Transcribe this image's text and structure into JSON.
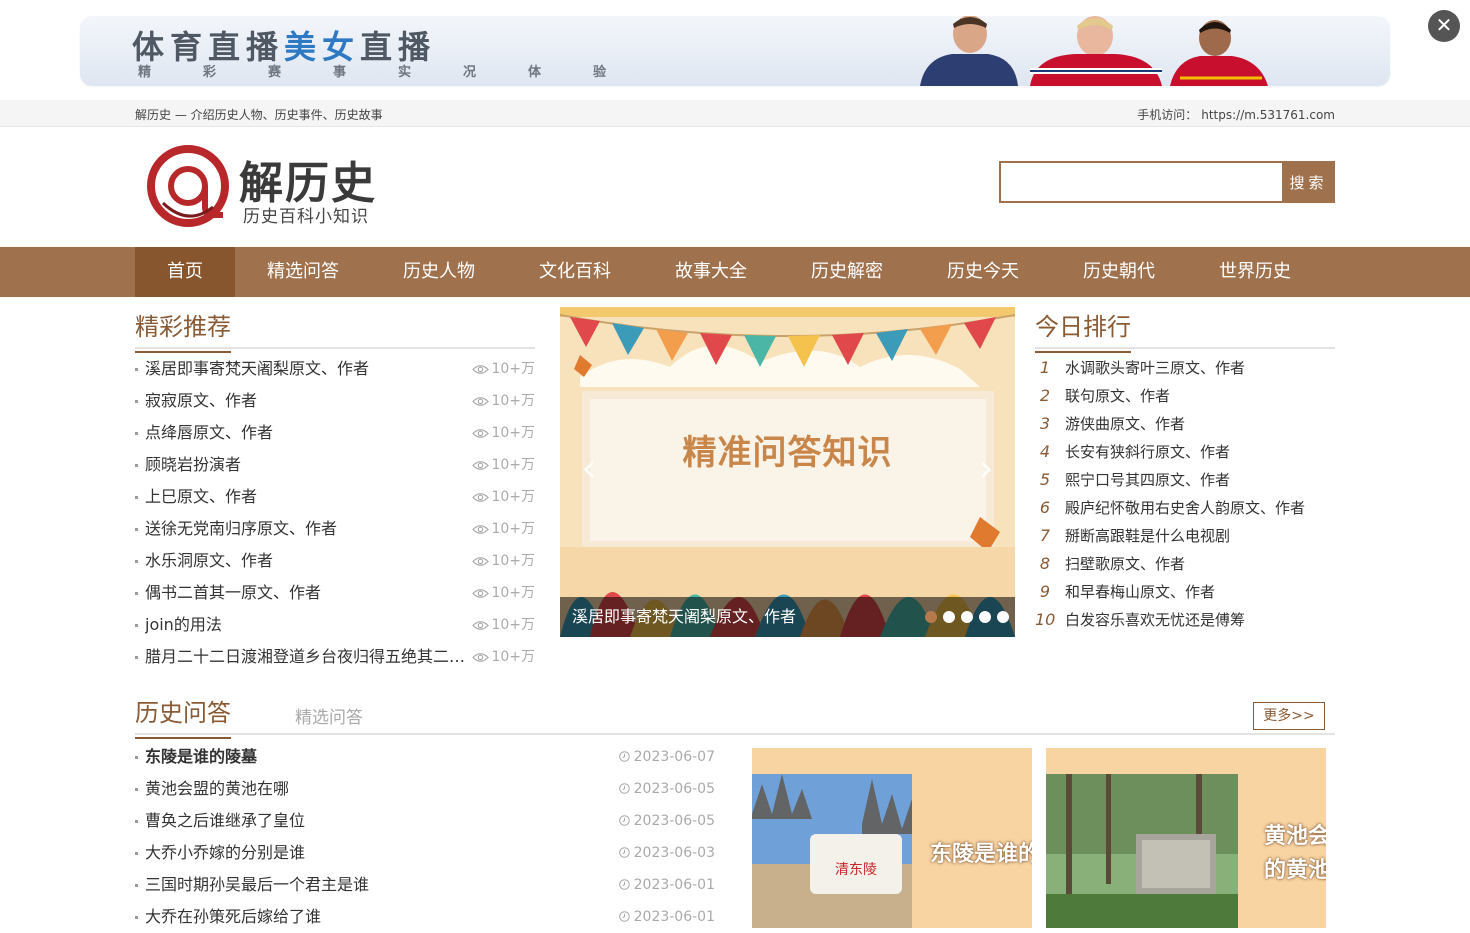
{
  "ad": {
    "title_part1": "体育直播",
    "title_part2": "美女",
    "title_part3": "直播",
    "subtitle": "精彩赛事实况体验"
  },
  "topbar": {
    "tagline": "解历史 — 介绍历史人物、历史事件、历史故事",
    "mobile_label": "手机访问：",
    "mobile_url": "https://m.531761.com"
  },
  "logo": {
    "name": "解历史",
    "tagline": "历史百科小知识"
  },
  "search": {
    "placeholder": "",
    "button": "搜索"
  },
  "nav": [
    "首页",
    "精选问答",
    "历史人物",
    "文化百科",
    "故事大全",
    "历史解密",
    "历史今天",
    "历史朝代",
    "世界历史"
  ],
  "recommend": {
    "title": "精彩推荐",
    "items": [
      {
        "title": "溪居即事寄梵天阇梨原文、作者",
        "views": "10+万"
      },
      {
        "title": "寂寂原文、作者",
        "views": "10+万"
      },
      {
        "title": "点绛唇原文、作者",
        "views": "10+万"
      },
      {
        "title": "顾晓岩扮演者",
        "views": "10+万"
      },
      {
        "title": "上巳原文、作者",
        "views": "10+万"
      },
      {
        "title": "送徐无党南归序原文、作者",
        "views": "10+万"
      },
      {
        "title": "水乐洞原文、作者",
        "views": "10+万"
      },
      {
        "title": "偶书二首其一原文、作者",
        "views": "10+万"
      },
      {
        "title": "join的用法",
        "views": "10+万"
      },
      {
        "title": "腊月二十二日渡湘登道乡台夜归得五绝其二原文、作者",
        "views": "10+万"
      }
    ]
  },
  "slider": {
    "headline": "精准问答知识",
    "caption": "溪居即事寄梵天阇梨原文、作者",
    "prev": "‹",
    "next": "›",
    "active_dot": 0,
    "dot_count": 5
  },
  "ranking": {
    "title": "今日排行",
    "items": [
      {
        "n": "1",
        "title": "水调歌头寄叶三原文、作者"
      },
      {
        "n": "2",
        "title": "联句原文、作者"
      },
      {
        "n": "3",
        "title": "游侠曲原文、作者"
      },
      {
        "n": "4",
        "title": "长安有狭斜行原文、作者"
      },
      {
        "n": "5",
        "title": "熙宁口号其四原文、作者"
      },
      {
        "n": "6",
        "title": "殿庐纪怀敬用右史舍人韵原文、作者"
      },
      {
        "n": "7",
        "title": "掰断高跟鞋是什么电视剧"
      },
      {
        "n": "8",
        "title": "扫壁歌原文、作者"
      },
      {
        "n": "9",
        "title": "和早春梅山原文、作者"
      },
      {
        "n": "10",
        "title": "白发容乐喜欢无忧还是傅筹"
      }
    ]
  },
  "qa": {
    "title": "历史问答",
    "tab2": "精选问答",
    "more": "更多>>",
    "items": [
      {
        "title": "东陵是谁的陵墓",
        "date": "2023-06-07"
      },
      {
        "title": "黄池会盟的黄池在哪",
        "date": "2023-06-05"
      },
      {
        "title": "曹奂之后谁继承了皇位",
        "date": "2023-06-05"
      },
      {
        "title": "大乔小乔嫁的分别是谁",
        "date": "2023-06-03"
      },
      {
        "title": "三国时期孙吴最后一个君主是谁",
        "date": "2023-06-01"
      },
      {
        "title": "大乔在孙策死后嫁给了谁",
        "date": "2023-06-01"
      }
    ],
    "thumbs": [
      {
        "caption": "东陵是谁的",
        "stone_text": "清东陵"
      },
      {
        "caption": "黄池会",
        "caption2": "的黄池"
      }
    ]
  },
  "colors": {
    "brand": "#a0714d",
    "nav_active": "#87552e",
    "title": "#8a5a35"
  }
}
